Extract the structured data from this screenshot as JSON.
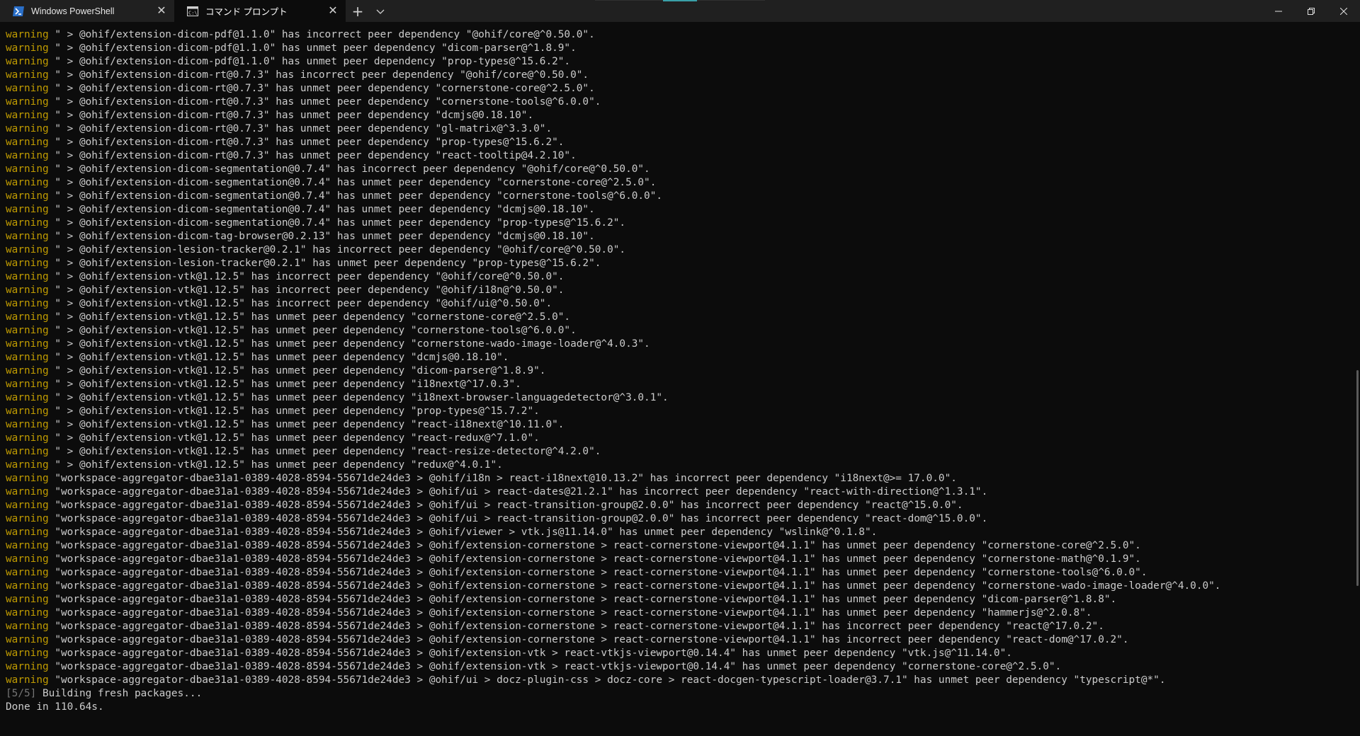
{
  "tabs": [
    {
      "title": "Windows PowerShell",
      "icon": "powershell-icon",
      "active": false
    },
    {
      "title": "コマンド プロンプト",
      "icon": "cmd-icon",
      "active": true
    }
  ],
  "titlebar": {
    "new_tab_glyph": "+",
    "close_glyph": "✕"
  },
  "terminal": {
    "warning_keyword": "warning",
    "lines": [
      "\" > @ohif/extension-dicom-pdf@1.1.0\" has incorrect peer dependency \"@ohif/core@^0.50.0\".",
      "\" > @ohif/extension-dicom-pdf@1.1.0\" has unmet peer dependency \"dicom-parser@^1.8.9\".",
      "\" > @ohif/extension-dicom-pdf@1.1.0\" has unmet peer dependency \"prop-types@^15.6.2\".",
      "\" > @ohif/extension-dicom-rt@0.7.3\" has incorrect peer dependency \"@ohif/core@^0.50.0\".",
      "\" > @ohif/extension-dicom-rt@0.7.3\" has unmet peer dependency \"cornerstone-core@^2.5.0\".",
      "\" > @ohif/extension-dicom-rt@0.7.3\" has unmet peer dependency \"cornerstone-tools@^6.0.0\".",
      "\" > @ohif/extension-dicom-rt@0.7.3\" has unmet peer dependency \"dcmjs@0.18.10\".",
      "\" > @ohif/extension-dicom-rt@0.7.3\" has unmet peer dependency \"gl-matrix@^3.3.0\".",
      "\" > @ohif/extension-dicom-rt@0.7.3\" has unmet peer dependency \"prop-types@^15.6.2\".",
      "\" > @ohif/extension-dicom-rt@0.7.3\" has unmet peer dependency \"react-tooltip@4.2.10\".",
      "\" > @ohif/extension-dicom-segmentation@0.7.4\" has incorrect peer dependency \"@ohif/core@^0.50.0\".",
      "\" > @ohif/extension-dicom-segmentation@0.7.4\" has unmet peer dependency \"cornerstone-core@^2.5.0\".",
      "\" > @ohif/extension-dicom-segmentation@0.7.4\" has unmet peer dependency \"cornerstone-tools@^6.0.0\".",
      "\" > @ohif/extension-dicom-segmentation@0.7.4\" has unmet peer dependency \"dcmjs@0.18.10\".",
      "\" > @ohif/extension-dicom-segmentation@0.7.4\" has unmet peer dependency \"prop-types@^15.6.2\".",
      "\" > @ohif/extension-dicom-tag-browser@0.2.13\" has unmet peer dependency \"dcmjs@0.18.10\".",
      "\" > @ohif/extension-lesion-tracker@0.2.1\" has incorrect peer dependency \"@ohif/core@^0.50.0\".",
      "\" > @ohif/extension-lesion-tracker@0.2.1\" has unmet peer dependency \"prop-types@^15.6.2\".",
      "\" > @ohif/extension-vtk@1.12.5\" has incorrect peer dependency \"@ohif/core@^0.50.0\".",
      "\" > @ohif/extension-vtk@1.12.5\" has incorrect peer dependency \"@ohif/i18n@^0.50.0\".",
      "\" > @ohif/extension-vtk@1.12.5\" has incorrect peer dependency \"@ohif/ui@^0.50.0\".",
      "\" > @ohif/extension-vtk@1.12.5\" has unmet peer dependency \"cornerstone-core@^2.5.0\".",
      "\" > @ohif/extension-vtk@1.12.5\" has unmet peer dependency \"cornerstone-tools@^6.0.0\".",
      "\" > @ohif/extension-vtk@1.12.5\" has unmet peer dependency \"cornerstone-wado-image-loader@^4.0.3\".",
      "\" > @ohif/extension-vtk@1.12.5\" has unmet peer dependency \"dcmjs@0.18.10\".",
      "\" > @ohif/extension-vtk@1.12.5\" has unmet peer dependency \"dicom-parser@^1.8.9\".",
      "\" > @ohif/extension-vtk@1.12.5\" has unmet peer dependency \"i18next@^17.0.3\".",
      "\" > @ohif/extension-vtk@1.12.5\" has unmet peer dependency \"i18next-browser-languagedetector@^3.0.1\".",
      "\" > @ohif/extension-vtk@1.12.5\" has unmet peer dependency \"prop-types@^15.7.2\".",
      "\" > @ohif/extension-vtk@1.12.5\" has unmet peer dependency \"react-i18next@^10.11.0\".",
      "\" > @ohif/extension-vtk@1.12.5\" has unmet peer dependency \"react-redux@^7.1.0\".",
      "\" > @ohif/extension-vtk@1.12.5\" has unmet peer dependency \"react-resize-detector@^4.2.0\".",
      "\" > @ohif/extension-vtk@1.12.5\" has unmet peer dependency \"redux@^4.0.1\".",
      "\"workspace-aggregator-dbae31a1-0389-4028-8594-55671de24de3 > @ohif/i18n > react-i18next@10.13.2\" has incorrect peer dependency \"i18next@>= 17.0.0\".",
      "\"workspace-aggregator-dbae31a1-0389-4028-8594-55671de24de3 > @ohif/ui > react-dates@21.2.1\" has incorrect peer dependency \"react-with-direction@^1.3.1\".",
      "\"workspace-aggregator-dbae31a1-0389-4028-8594-55671de24de3 > @ohif/ui > react-transition-group@2.0.0\" has incorrect peer dependency \"react@^15.0.0\".",
      "\"workspace-aggregator-dbae31a1-0389-4028-8594-55671de24de3 > @ohif/ui > react-transition-group@2.0.0\" has incorrect peer dependency \"react-dom@^15.0.0\".",
      "\"workspace-aggregator-dbae31a1-0389-4028-8594-55671de24de3 > @ohif/viewer > vtk.js@11.14.0\" has unmet peer dependency \"wslink@^0.1.8\".",
      "\"workspace-aggregator-dbae31a1-0389-4028-8594-55671de24de3 > @ohif/extension-cornerstone > react-cornerstone-viewport@4.1.1\" has unmet peer dependency \"cornerstone-core@^2.5.0\".",
      "\"workspace-aggregator-dbae31a1-0389-4028-8594-55671de24de3 > @ohif/extension-cornerstone > react-cornerstone-viewport@4.1.1\" has unmet peer dependency \"cornerstone-math@^0.1.9\".",
      "\"workspace-aggregator-dbae31a1-0389-4028-8594-55671de24de3 > @ohif/extension-cornerstone > react-cornerstone-viewport@4.1.1\" has unmet peer dependency \"cornerstone-tools@^6.0.0\".",
      "\"workspace-aggregator-dbae31a1-0389-4028-8594-55671de24de3 > @ohif/extension-cornerstone > react-cornerstone-viewport@4.1.1\" has unmet peer dependency \"cornerstone-wado-image-loader@^4.0.0\".",
      "\"workspace-aggregator-dbae31a1-0389-4028-8594-55671de24de3 > @ohif/extension-cornerstone > react-cornerstone-viewport@4.1.1\" has unmet peer dependency \"dicom-parser@^1.8.8\".",
      "\"workspace-aggregator-dbae31a1-0389-4028-8594-55671de24de3 > @ohif/extension-cornerstone > react-cornerstone-viewport@4.1.1\" has unmet peer dependency \"hammerjs@^2.0.8\".",
      "\"workspace-aggregator-dbae31a1-0389-4028-8594-55671de24de3 > @ohif/extension-cornerstone > react-cornerstone-viewport@4.1.1\" has incorrect peer dependency \"react@^17.0.2\".",
      "\"workspace-aggregator-dbae31a1-0389-4028-8594-55671de24de3 > @ohif/extension-cornerstone > react-cornerstone-viewport@4.1.1\" has incorrect peer dependency \"react-dom@^17.0.2\".",
      "\"workspace-aggregator-dbae31a1-0389-4028-8594-55671de24de3 > @ohif/extension-vtk > react-vtkjs-viewport@0.14.4\" has unmet peer dependency \"vtk.js@^11.14.0\".",
      "\"workspace-aggregator-dbae31a1-0389-4028-8594-55671de24de3 > @ohif/extension-vtk > react-vtkjs-viewport@0.14.4\" has unmet peer dependency \"cornerstone-core@^2.5.0\".",
      "\"workspace-aggregator-dbae31a1-0389-4028-8594-55671de24de3 > @ohif/ui > docz-plugin-css > docz-core > react-docgen-typescript-loader@3.7.1\" has unmet peer dependency \"typescript@*\"."
    ],
    "build_step": {
      "prefix": "[5/5]",
      "text": " Building fresh packages..."
    },
    "done_text": "Done in 110.64s."
  },
  "colors": {
    "warning": "#c19c00",
    "text": "#cccccc",
    "background": "#0c0c0c",
    "titlebar": "#202020",
    "step_prefix": "#767676"
  }
}
